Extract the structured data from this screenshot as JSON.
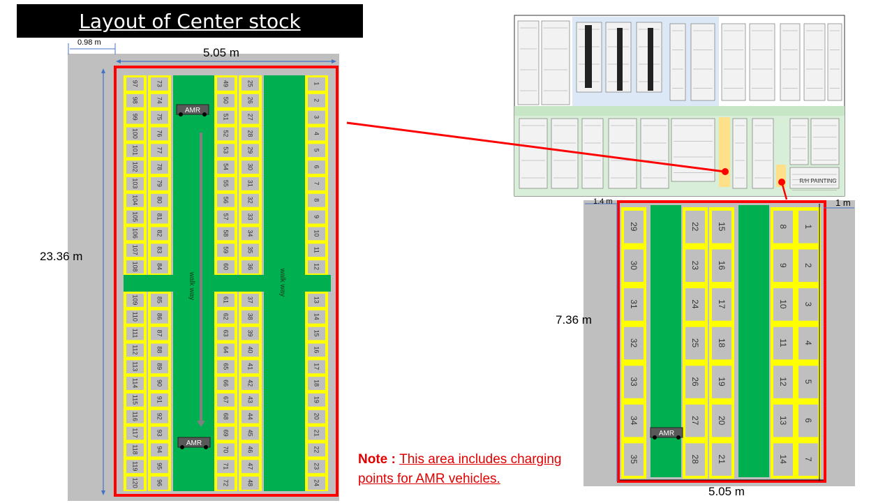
{
  "title": "Layout of Center stock",
  "colors": {
    "floor": "#bfbfbf",
    "boundary": "#ff0000",
    "walkway": "#00b050",
    "slot_border": "#ffff00",
    "slot_fill": "#bfbfbf",
    "dimension_line": "#4472c4",
    "amr": "#595959"
  },
  "left_layout": {
    "width_label": "5.05 m",
    "height_label": "23.36 m",
    "offset_label": "0.98 m",
    "walkway_labels": [
      "walk way",
      "walk way"
    ],
    "amr_labels": [
      "AMR",
      "AMR"
    ],
    "columns": [
      {
        "top": [
          97,
          98,
          99,
          100,
          101,
          102,
          103,
          104,
          105,
          106,
          107,
          108
        ],
        "bottom": [
          109,
          110,
          111,
          112,
          113,
          114,
          115,
          116,
          117,
          118,
          119,
          120
        ]
      },
      {
        "top": [
          73,
          74,
          75,
          76,
          77,
          78,
          79,
          80,
          81,
          82,
          83,
          84
        ],
        "bottom": [
          85,
          86,
          87,
          88,
          89,
          90,
          91,
          92,
          93,
          94,
          95,
          96
        ]
      },
      {
        "top": [
          49,
          50,
          51,
          52,
          53,
          54,
          55,
          56,
          57,
          58,
          59,
          60
        ],
        "bottom": [
          61,
          62,
          63,
          64,
          65,
          66,
          67,
          68,
          69,
          70,
          71,
          72
        ]
      },
      {
        "top": [
          25,
          26,
          27,
          28,
          29,
          30,
          31,
          32,
          33,
          34,
          35,
          36
        ],
        "bottom": [
          37,
          38,
          39,
          40,
          41,
          42,
          43,
          44,
          45,
          46,
          47,
          48
        ]
      },
      {
        "top": [
          1,
          2,
          3,
          4,
          5,
          6,
          7,
          8,
          9,
          10,
          11,
          12
        ],
        "bottom": [
          13,
          14,
          15,
          16,
          17,
          18,
          19,
          20,
          21,
          22,
          23,
          24
        ]
      }
    ]
  },
  "right_layout": {
    "width_label": "5.05 m",
    "height_label": "7.36 m",
    "left_offset_label": "1.4 m",
    "right_offset_label": "1 m",
    "amr_label": "AMR",
    "columns": [
      [
        29,
        30,
        31,
        32,
        33,
        34,
        35
      ],
      [
        22,
        23,
        24,
        25,
        26,
        27,
        28
      ],
      [
        15,
        16,
        17,
        18,
        19,
        20,
        21
      ],
      [
        8,
        9,
        10,
        11,
        12,
        13,
        14
      ],
      [
        1,
        2,
        3,
        4,
        5,
        6,
        7
      ]
    ]
  },
  "plant_map": {
    "labels": [
      "R/H PAINTING"
    ]
  },
  "note": {
    "prefix": "Note :",
    "text": "This area includes charging points for AMR vehicles."
  }
}
